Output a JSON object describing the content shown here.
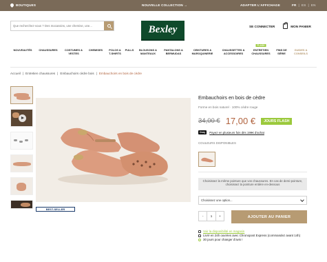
{
  "topbar": {
    "stores": "BOUTIQUES",
    "collection": "NOUVELLE COLLECTION →",
    "display": "ADAPTER L'AFFICHAGE",
    "langs": [
      "FR",
      "ES",
      "EN"
    ]
  },
  "header": {
    "search_placeholder": "Que recherchez-vous ? Des mocassins, une chemise, une...",
    "logo": "Bexley",
    "login": "SE CONNECTER",
    "cart": "MON PANIER"
  },
  "nav": [
    {
      "label": "NOUVEAUTÉS"
    },
    {
      "label": "CHAUSSURES"
    },
    {
      "label": "COSTUMES & VESTES"
    },
    {
      "label": "CHEMISES"
    },
    {
      "label": "POLOS & T-SHIRTS"
    },
    {
      "label": "PULLS"
    },
    {
      "label": "BLOUSONS & MANTEAUX"
    },
    {
      "label": "PANTALONS & BERMUDAS"
    },
    {
      "label": "CEINTURES & MAROQUINERIE"
    },
    {
      "label": "CHAUSSETTES & ACCESSOIRES"
    },
    {
      "label": "ENTRETIEN CHAUSSURES",
      "tag": "FLASH"
    },
    {
      "label": "FINS DE SÉRIE"
    },
    {
      "label": "GUIDES & CONSEILS"
    }
  ],
  "breadcrumb": [
    "Accueil",
    "Entretien chaussures",
    "Embauchoirs cèdre bois",
    "Embauchoirs en bois de cèdre"
  ],
  "badge": "BEST-SELLER",
  "product": {
    "title": "Embauchoirs en bois de cèdre",
    "subtitle": "Forme en bois naturel · 100% cèdre rouge",
    "old_price": "34,00 €",
    "price": "17,00 €",
    "flash": "JOURS FLASH",
    "pay_icon": "Oney",
    "pay_text": "Payez en plusieurs fois dès 199€ d'achat",
    "colors_label": "COULEURS DISPONIBLES",
    "note": "Choisissez la même pointure que vos chaussures. En cas de demi-pointure, choisissez la pointure entière en-dessous",
    "select": "Choisissez une option...",
    "qty": {
      "minus": "-",
      "value": "1",
      "plus": "+"
    },
    "add_to_cart": "AJOUTER AU PANIER",
    "availability": "Voir la disponibilité en magasin",
    "delivery": "Livré en 24h ouvrées avec Chronopost Express (commandez avant 14h)",
    "returns": "30 jours pour changer d'avis !"
  },
  "colors": {
    "accent": "#b79b73",
    "topbar": "#7a6a58",
    "logo": "#0f4a2b",
    "flash": "#9bc93c",
    "price": "#b0623d"
  }
}
